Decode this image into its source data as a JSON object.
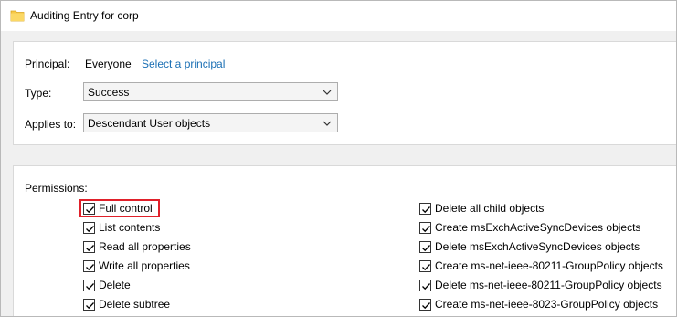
{
  "window": {
    "title": "Auditing Entry for corp",
    "icon": "folder-icon"
  },
  "principal": {
    "label": "Principal:",
    "value": "Everyone",
    "link": "Select a principal"
  },
  "type": {
    "label": "Type:",
    "value": "Success"
  },
  "applies_to": {
    "label": "Applies to:",
    "value": "Descendant User objects"
  },
  "permissions": {
    "label": "Permissions:",
    "left": [
      {
        "label": "Full control",
        "checked": true
      },
      {
        "label": "List contents",
        "checked": true
      },
      {
        "label": "Read all properties",
        "checked": true
      },
      {
        "label": "Write all properties",
        "checked": true
      },
      {
        "label": "Delete",
        "checked": true
      },
      {
        "label": "Delete subtree",
        "checked": true
      }
    ],
    "right": [
      {
        "label": "Delete all child objects",
        "checked": true
      },
      {
        "label": "Create msExchActiveSyncDevices objects",
        "checked": true
      },
      {
        "label": "Delete msExchActiveSyncDevices objects",
        "checked": true
      },
      {
        "label": "Create ms-net-ieee-80211-GroupPolicy objects",
        "checked": true
      },
      {
        "label": "Delete ms-net-ieee-80211-GroupPolicy objects",
        "checked": true
      },
      {
        "label": "Create ms-net-ieee-8023-GroupPolicy objects",
        "checked": true
      }
    ]
  },
  "colors": {
    "link": "#1a6fb4",
    "highlight": "#e0202a",
    "folder": "#f7c948"
  }
}
